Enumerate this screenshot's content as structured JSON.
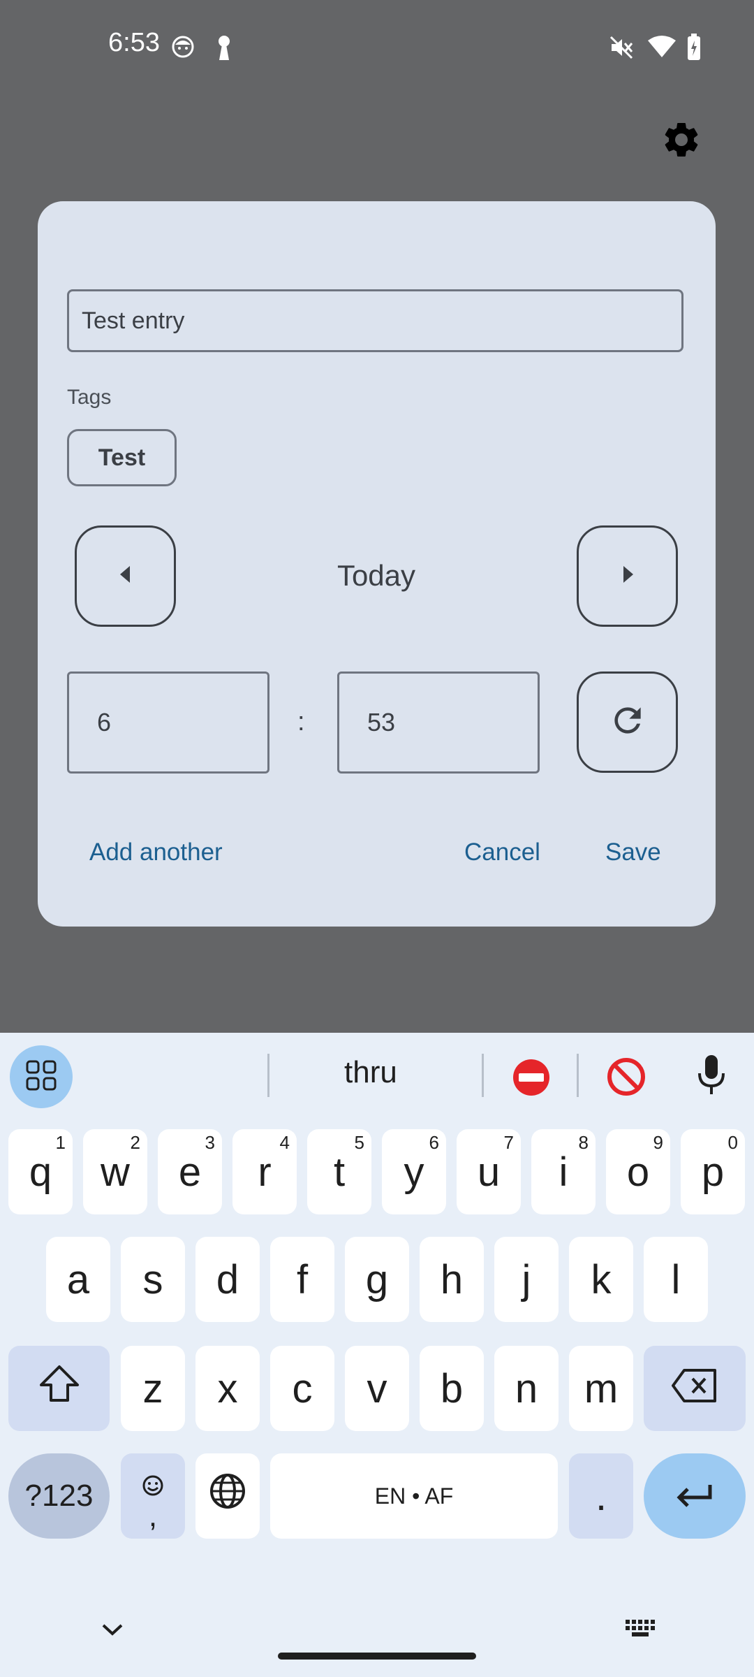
{
  "status_bar": {
    "time": "6:53",
    "icons": [
      "face-notification-icon",
      "keyhole-icon",
      "mute-icon",
      "wifi-icon",
      "battery-charging-icon"
    ]
  },
  "toolbar": {
    "settings_icon": "gear-icon"
  },
  "dialog": {
    "entry_name": "Test entry",
    "tags_label": "Tags",
    "tags": [
      "Test"
    ],
    "date_label": "Today",
    "hour": "6",
    "time_separator": ":",
    "minute": "53",
    "add_another_label": "Add another",
    "cancel_label": "Cancel",
    "save_label": "Save"
  },
  "keyboard": {
    "suggestions": [
      "thru"
    ],
    "row1": [
      {
        "k": "q",
        "h": "1"
      },
      {
        "k": "w",
        "h": "2"
      },
      {
        "k": "e",
        "h": "3"
      },
      {
        "k": "r",
        "h": "4"
      },
      {
        "k": "t",
        "h": "5"
      },
      {
        "k": "y",
        "h": "6"
      },
      {
        "k": "u",
        "h": "7"
      },
      {
        "k": "i",
        "h": "8"
      },
      {
        "k": "o",
        "h": "9"
      },
      {
        "k": "p",
        "h": "0"
      }
    ],
    "row2": [
      "a",
      "s",
      "d",
      "f",
      "g",
      "h",
      "j",
      "k",
      "l"
    ],
    "row3": [
      "z",
      "x",
      "c",
      "v",
      "b",
      "n",
      "m"
    ],
    "symbols_label": "?123",
    "comma_label": ",",
    "space_label": "EN • AF",
    "period_label": "."
  },
  "colors": {
    "scrim": "#646567",
    "dialog_bg": "#dce3ee",
    "accent": "#1c5f90",
    "keyboard_bg": "#e8eff8"
  }
}
